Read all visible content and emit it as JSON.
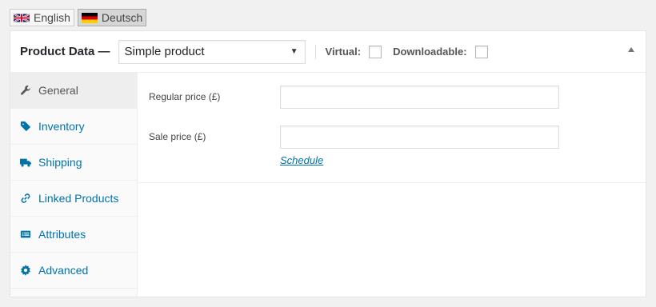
{
  "languages": [
    {
      "label": "English",
      "active": false
    },
    {
      "label": "Deutsch",
      "active": true
    }
  ],
  "panel": {
    "title": "Product Data —",
    "product_type": "Simple product",
    "virtual_label": "Virtual:",
    "downloadable_label": "Downloadable:",
    "virtual_checked": false,
    "downloadable_checked": false
  },
  "tabs": [
    {
      "label": "General",
      "icon": "wrench-icon",
      "active": true
    },
    {
      "label": "Inventory",
      "icon": "tag-icon",
      "active": false
    },
    {
      "label": "Shipping",
      "icon": "truck-icon",
      "active": false
    },
    {
      "label": "Linked Products",
      "icon": "link-icon",
      "active": false
    },
    {
      "label": "Attributes",
      "icon": "list-card-icon",
      "active": false
    },
    {
      "label": "Advanced",
      "icon": "gear-icon",
      "active": false
    }
  ],
  "general": {
    "regular_price_label": "Regular price (£)",
    "regular_price_value": "",
    "sale_price_label": "Sale price (£)",
    "sale_price_value": "",
    "schedule_link": "Schedule"
  },
  "colors": {
    "link": "#0073aa",
    "active_tab_bg": "#eeeeee",
    "tab_bg": "#fafafa"
  }
}
